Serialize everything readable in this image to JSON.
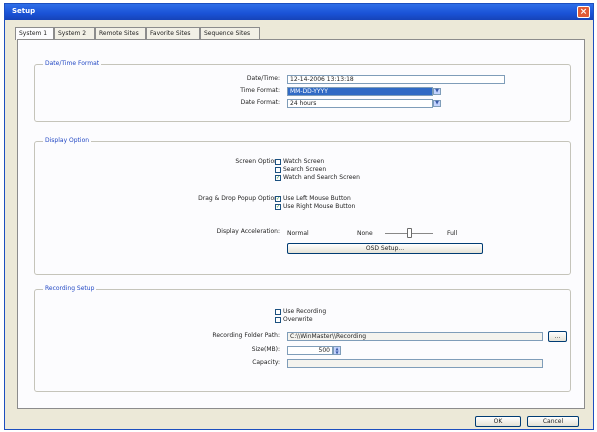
{
  "window": {
    "title": "Setup",
    "close_glyph": "×"
  },
  "tabs": [
    {
      "label": "System 1",
      "active": true
    },
    {
      "label": "System 2"
    },
    {
      "label": "Remote Sites"
    },
    {
      "label": "Favorite Sites"
    },
    {
      "label": "Sequence Sites"
    }
  ],
  "datetime": {
    "group_title": "Date/Time Format",
    "datetime_label": "Date/Time:",
    "datetime_value": "12-14-2006  13:13:18",
    "time_format_label": "Time Format:",
    "time_format_value": "MM-DD-YYYY",
    "date_format_label": "Date Format:",
    "date_format_value": "24 hours"
  },
  "display": {
    "group_title": "Display Option",
    "screen_option_label": "Screen Option:",
    "screen_options": [
      {
        "label": "Watch Screen",
        "checked": false
      },
      {
        "label": "Search Screen",
        "checked": false
      },
      {
        "label": "Watch and Search Screen",
        "checked": true
      }
    ],
    "dragdrop_label": "Drag & Drop Popup Option:",
    "dragdrop_options": [
      {
        "label": "Use Left Mouse Button",
        "checked": true
      },
      {
        "label": "Use Right Mouse Button",
        "checked": true
      }
    ],
    "acceleration_label": "Display Acceleration:",
    "accel_normal": "Normal",
    "accel_none": "None",
    "accel_full": "Full",
    "accel_level": 0.5,
    "osd_button": "OSD Setup..."
  },
  "recording": {
    "group_title": "Recording Setup",
    "use_recording": {
      "label": "Use Recording",
      "checked": false
    },
    "overwrite": {
      "label": "Overwrite",
      "checked": false
    },
    "folder_label": "Recording Folder Path:",
    "folder_value": "C:\\\\WinMaster\\\\Recording",
    "browse_button": "...",
    "size_label": "Size(MB):",
    "size_value": "500",
    "capacity_label": "Capacity:",
    "capacity_value": ""
  },
  "footer": {
    "ok": "OK",
    "cancel": "Cancel"
  },
  "icons": {
    "close": "close-icon",
    "dropdown": "chevron-down-icon",
    "spin": "spin-updown-icon",
    "check": "check-icon"
  },
  "colors": {
    "titlebar": "#1a52d6",
    "group_title": "#2349c4",
    "selection": "#316ac5"
  }
}
